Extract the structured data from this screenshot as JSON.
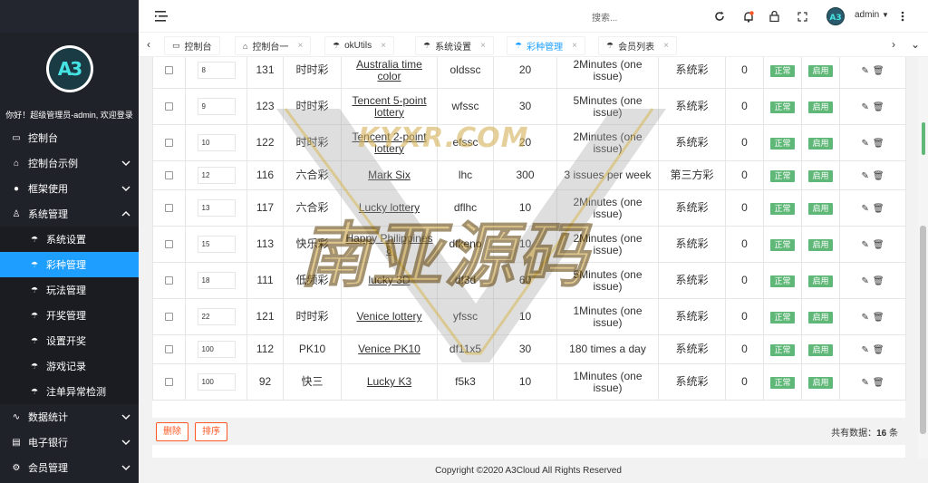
{
  "sidebar": {
    "logo_text": "A3",
    "welcome": "你好！超级管理员-admin, 欢迎登录",
    "items": [
      {
        "label": "控制台",
        "icon": "monitor-icon"
      },
      {
        "label": "控制台示例",
        "icon": "home-icon",
        "has_children": true
      },
      {
        "label": "框架使用",
        "icon": "gamepad-icon",
        "has_children": true
      },
      {
        "label": "系统管理",
        "icon": "user-icon",
        "has_children": true,
        "expanded": true
      }
    ],
    "sub_items": [
      {
        "label": "系统设置"
      },
      {
        "label": "彩种管理",
        "active": true
      },
      {
        "label": "玩法管理"
      },
      {
        "label": "开奖管理"
      },
      {
        "label": "设置开奖"
      },
      {
        "label": "游戏记录"
      },
      {
        "label": "注单异常检测"
      }
    ],
    "bottom_items": [
      {
        "label": "数据统计",
        "icon": "chart-icon"
      },
      {
        "label": "电子银行",
        "icon": "bank-icon"
      },
      {
        "label": "会员管理",
        "icon": "gear-icon"
      }
    ]
  },
  "header": {
    "search_placeholder": "搜索...",
    "user": "admin"
  },
  "tabs": [
    {
      "label": "控制台",
      "icon": "monitor-icon",
      "closable": false
    },
    {
      "label": "控制台一",
      "icon": "home-icon",
      "closable": true
    },
    {
      "label": "okUtils",
      "icon": "umbrella-icon",
      "closable": true
    },
    {
      "label": "系统设置",
      "icon": "umbrella-icon",
      "closable": true
    },
    {
      "label": "彩种管理",
      "icon": "umbrella-icon",
      "closable": true,
      "active": true
    },
    {
      "label": "会员列表",
      "icon": "umbrella-icon",
      "closable": true
    }
  ],
  "table": {
    "rows": [
      {
        "sort": "8",
        "id": "131",
        "type": "时时彩",
        "name": "Australia time color",
        "code": "oldssc",
        "count": "20",
        "freq": "2Minutes (one issue)",
        "category": "系统彩",
        "zero": "0",
        "status": "正常",
        "enabled": "启用"
      },
      {
        "sort": "9",
        "id": "123",
        "type": "时时彩",
        "name": "Tencent 5-point lottery",
        "code": "wfssc",
        "count": "30",
        "freq": "5Minutes (one issue)",
        "category": "系统彩",
        "zero": "0",
        "status": "正常",
        "enabled": "启用"
      },
      {
        "sort": "10",
        "id": "122",
        "type": "时时彩",
        "name": "Tencent 2-point lottery",
        "code": "efssc",
        "count": "20",
        "freq": "2Minutes (one issue)",
        "category": "系统彩",
        "zero": "0",
        "status": "正常",
        "enabled": "启用"
      },
      {
        "sort": "12",
        "id": "116",
        "type": "六合彩",
        "name": "Mark Six",
        "code": "lhc",
        "count": "300",
        "freq": "3 issues per week",
        "category": "第三方彩",
        "zero": "0",
        "status": "正常",
        "enabled": "启用"
      },
      {
        "sort": "13",
        "id": "117",
        "type": "六合彩",
        "name": "Lucky lottery",
        "code": "dflhc",
        "count": "10",
        "freq": "2Minutes (one issue)",
        "category": "系统彩",
        "zero": "0",
        "status": "正常",
        "enabled": "启用"
      },
      {
        "sort": "15",
        "id": "113",
        "type": "快乐彩",
        "name": "Happy Philippines 8",
        "code": "dfkeno",
        "count": "10",
        "freq": "2Minutes (one issue)",
        "category": "系统彩",
        "zero": "0",
        "status": "正常",
        "enabled": "启用"
      },
      {
        "sort": "18",
        "id": "111",
        "type": "低频彩",
        "name": "lucky 3D",
        "code": "df3d",
        "count": "60",
        "freq": "5Minutes (one issue)",
        "category": "系统彩",
        "zero": "0",
        "status": "正常",
        "enabled": "启用"
      },
      {
        "sort": "22",
        "id": "121",
        "type": "时时彩",
        "name": "Venice lottery",
        "code": "yfssc",
        "count": "10",
        "freq": "1Minutes (one issue)",
        "category": "系统彩",
        "zero": "0",
        "status": "正常",
        "enabled": "启用"
      },
      {
        "sort": "100",
        "id": "112",
        "type": "PK10",
        "name": "Venice PK10",
        "code": "df11x5",
        "count": "30",
        "freq": "180 times a day",
        "category": "系统彩",
        "zero": "0",
        "status": "正常",
        "enabled": "启用"
      },
      {
        "sort": "100",
        "id": "92",
        "type": "快三",
        "name": "Lucky K3",
        "code": "f5k3",
        "count": "10",
        "freq": "1Minutes (one issue)",
        "category": "系统彩",
        "zero": "0",
        "status": "正常",
        "enabled": "启用"
      }
    ]
  },
  "footer": {
    "delete_label": "删除",
    "sort_label": "排序",
    "total_prefix": "共有数据：",
    "total_count": "16",
    "total_suffix": "条"
  },
  "copyright": "Copyright ©2020 A3Cloud All Rights Reserved",
  "watermark": {
    "line1": "KYXR.COM",
    "line2": "南亚源码"
  }
}
